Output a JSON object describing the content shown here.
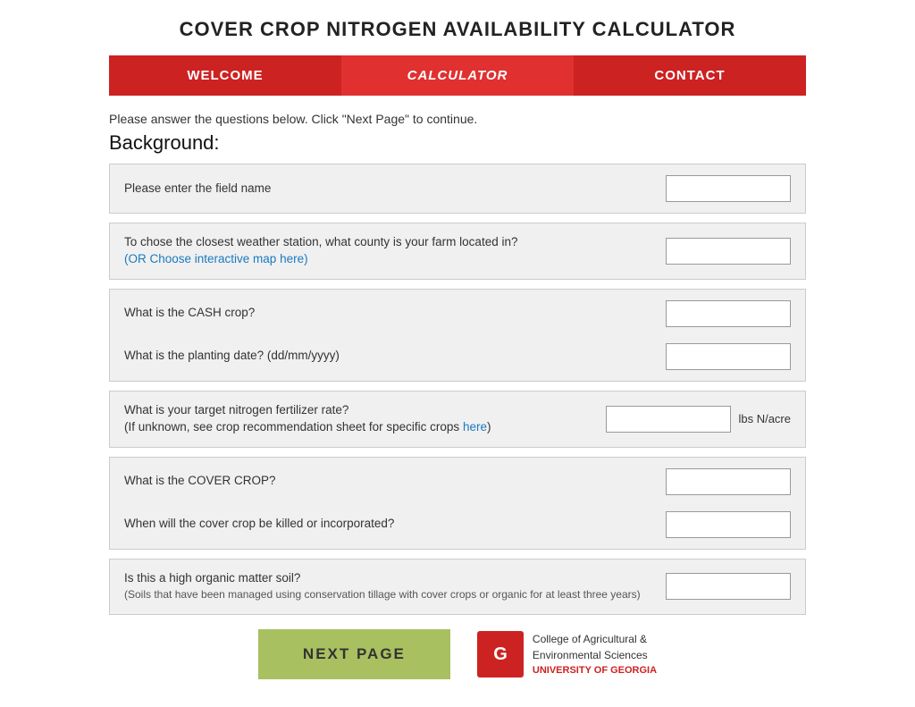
{
  "title": "COVER CROP NITROGEN AVAILABILITY CALCULATOR",
  "nav": {
    "items": [
      {
        "id": "welcome",
        "label": "WELCOME",
        "active": false
      },
      {
        "id": "calculator",
        "label": "CALCULATOR",
        "active": true
      },
      {
        "id": "contact",
        "label": "CONTACT",
        "active": false
      }
    ]
  },
  "instructions": "Please answer the questions below.  Click \"Next Page\" to continue.",
  "section_heading": "Background:",
  "questions": {
    "field_name": {
      "label": "Please enter the field name",
      "placeholder": ""
    },
    "county": {
      "label": "To chose the closest weather station, what county is your farm located in?",
      "link_text": "(OR Choose interactive map here)",
      "placeholder": ""
    },
    "cash_crop": {
      "label": "What is the CASH crop?",
      "placeholder": ""
    },
    "planting_date": {
      "label": "What is the planting date? (dd/mm/yyyy)",
      "placeholder": ""
    },
    "nitrogen_rate": {
      "label": "What is your target nitrogen fertilizer rate?",
      "sub_label": "(If unknown, see crop recommendation sheet for specific crops ",
      "link_text": "here",
      "sub_label_end": ")",
      "unit": "lbs N/acre",
      "placeholder": ""
    },
    "cover_crop": {
      "label": "What is the COVER CROP?",
      "placeholder": ""
    },
    "kill_date": {
      "label": "When will the cover crop be killed or incorporated?",
      "placeholder": ""
    },
    "organic_matter": {
      "label": "Is this a high organic matter soil?",
      "sub_label": "(Soils that have been managed using conservation tillage with cover crops or organic for at least three years)",
      "placeholder": ""
    }
  },
  "next_page_button": "NEXT PAGE",
  "logo": {
    "college": "College of Agricultural &",
    "env": "Environmental Sciences",
    "university": "UNIVERSITY OF GEORGIA"
  }
}
